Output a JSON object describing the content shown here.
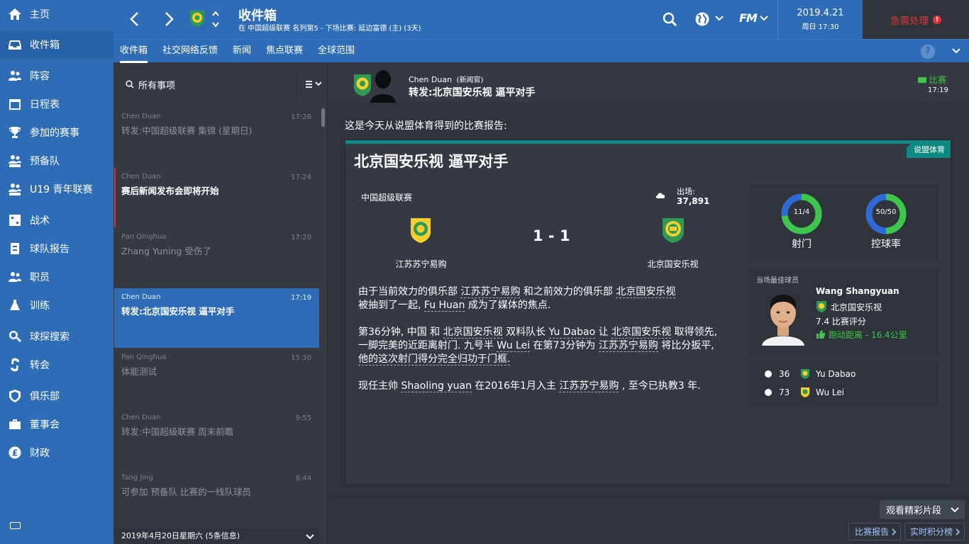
{
  "nav": [
    {
      "key": "home",
      "label": "主页",
      "icon": "home-icon"
    },
    {
      "key": "inbox",
      "label": "收件箱",
      "icon": "inbox-icon"
    },
    {
      "key": "squad",
      "label": "阵容",
      "icon": "people-icon"
    },
    {
      "key": "schedule",
      "label": "日程表",
      "icon": "calendar-icon"
    },
    {
      "key": "competitions",
      "label": "参加的赛事",
      "icon": "trophy-icon"
    },
    {
      "key": "reserves",
      "label": "预备队",
      "icon": "reserve-team-icon"
    },
    {
      "key": "u19",
      "label": "U19 青年联赛",
      "icon": "youth-team-icon"
    },
    {
      "key": "tactics",
      "label": "战术",
      "icon": "tactics-icon"
    },
    {
      "key": "team-report",
      "label": "球队报告",
      "icon": "report-icon"
    },
    {
      "key": "staff",
      "label": "职员",
      "icon": "staff-icon"
    },
    {
      "key": "training",
      "label": "训练",
      "icon": "training-icon"
    },
    {
      "key": "scouting",
      "label": "球探搜索",
      "icon": "search-icon"
    },
    {
      "key": "transfers",
      "label": "转会",
      "icon": "transfer-icon"
    },
    {
      "key": "club",
      "label": "俱乐部",
      "icon": "shield-icon"
    },
    {
      "key": "board",
      "label": "董事会",
      "icon": "briefcase-icon"
    },
    {
      "key": "finances",
      "label": "财政",
      "icon": "pound-icon"
    }
  ],
  "header": {
    "title": "收件箱",
    "subtitle": "在 中国超级联赛 名列第5 - 下场比赛: 延边富德 (主) (3天)",
    "date": "2019.4.21",
    "time": "周日 17:30",
    "urgent": "急需处理",
    "fm": "FM"
  },
  "tabs": [
    "收件箱",
    "社交网络反馈",
    "新闻",
    "焦点联赛",
    "全球范围"
  ],
  "search": {
    "label": "所有事项"
  },
  "messages": [
    {
      "sender": "Chen Duan",
      "time": "17:26",
      "subject": "转发:中国超级联赛 集锦 (星期日)",
      "state": "read"
    },
    {
      "sender": "Chen Duan",
      "time": "17:24",
      "subject": "赛后新闻发布会即将开始",
      "state": "unread"
    },
    {
      "sender": "Pan Qinghua",
      "time": "17:20",
      "subject": "Zhang Yuning 受伤了",
      "state": "read"
    },
    {
      "sender": "Chen Duan",
      "time": "17:19",
      "subject": "转发:北京国安乐视 逼平对手",
      "state": "selected"
    },
    {
      "sender": "Pan Qinghua",
      "time": "15:30",
      "subject": "体能测试",
      "state": "read"
    },
    {
      "sender": "Chen Duan",
      "time": "9:55",
      "subject": "转发:中国超级联赛 周末前瞻",
      "state": "read"
    },
    {
      "sender": "Tang Jing",
      "time": "8:44",
      "subject": "可参加 预备队 比赛的一线队球员",
      "state": "read"
    }
  ],
  "list_footer": "2019年4月20日星期六 (5条信息)",
  "detail": {
    "sender": "Chen Duan",
    "sender_role": "(新闻官)",
    "subject": "转发:北京国安乐视 逼平对手",
    "tag": "比赛",
    "time": "17:19",
    "intro": "这是今天从说盟体育得到的比赛报告:",
    "source": "说盟体育",
    "headline": "北京国安乐视 逼平对手",
    "competition": "中国超级联赛",
    "attendance_label": "出场:",
    "attendance": "37,891",
    "home_team": "江苏苏宁易购",
    "away_team": "北京国安乐视",
    "score": "1 - 1",
    "para1": {
      "a": "由于当前效力的俱乐部 ",
      "b": "江苏苏宁易购",
      "c": " 和之前效力的俱乐部 ",
      "d": "北京国安乐视",
      "e": "被抽到了一起, ",
      "f": "Fu Huan",
      "g": " 成为了媒体的焦点."
    },
    "para2": {
      "a": "第36分钟, 中国 和 ",
      "b": "北京国安乐视",
      "c": " 双料队长 ",
      "d": "Yu Dabao",
      "e": " 让 ",
      "f": "北京国安乐视",
      "g": " 取得领先,",
      "h": "一脚完美的近距离射门. 九号半 ",
      "i": "Wu Lei",
      "j": " 在第73分钟为 ",
      "k": "江苏苏宁易购",
      "l": " 将比分扳平,",
      "m": "他的这次射门得分完全归功于门框."
    },
    "para3": {
      "a": "现任主帅 ",
      "b": "Shaoling yuan",
      "c": " 在2016年1月入主 ",
      "d": "江苏苏宁易购",
      "e": " , 至今已执教3 年."
    },
    "stats": {
      "shots": "11/4",
      "shots_label": "射门",
      "shots_home_fraction": 0.73,
      "possession": "50/50",
      "possession_label": "控球率",
      "possession_home_fraction": 0.5
    },
    "motm": {
      "label": "当场最佳球员",
      "name": "Wang Shangyuan",
      "club": "北京国安乐视",
      "rating": "7.4 比赛评分",
      "distance": "跑动距离 - 16.4公里"
    },
    "goals": [
      {
        "minute": "36",
        "player": "Yu Dabao"
      },
      {
        "minute": "73",
        "player": "Wu Lei"
      }
    ]
  },
  "actions": {
    "highlights": "观看精彩片段",
    "match_report": "比赛报告",
    "live_table": "实时积分榜"
  },
  "colors": {
    "primary": "#2e6db6",
    "sidebar_active": "#2861a6",
    "accent_teal": "#0e8a84",
    "urgent": "#e0353a",
    "green": "#3ec64a",
    "donut_blue": "#2e6ad6"
  }
}
